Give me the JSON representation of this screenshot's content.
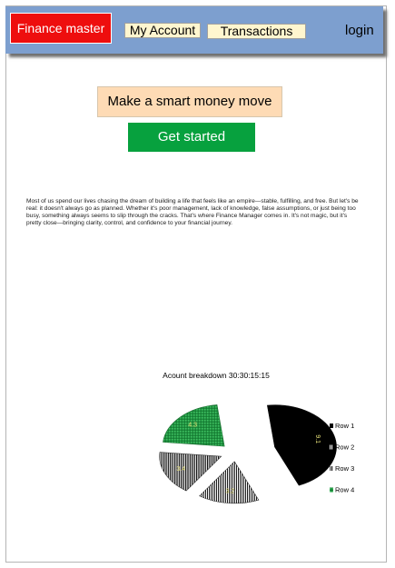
{
  "nav": {
    "brand": "Finance master",
    "account": "My Account",
    "transactions": "Transactions",
    "login": "login"
  },
  "hero": {
    "headline": "Make a smart money move",
    "cta": "Get started"
  },
  "intro": {
    "text": "Most of us spend our lives chasing the dream of building a life that feels like an empire—stable, fulfilling, and free. But let's be real: it doesn't always go as planned. Whether it's poor management, lack of knowledge, false assumptions, or just being too busy, something always seems to slip through the cracks. That's where Finance Manager comes in. It's not magic, but it's pretty close—bringing clarity, control, and confidence to your financial journey."
  },
  "chart_data": {
    "type": "pie",
    "title": "Acount breakdown 30:30:15:15",
    "categories": [
      "Row 1",
      "Row 2",
      "Row 3",
      "Row 4"
    ],
    "values": [
      9.1,
      3.2,
      3.4,
      4.3
    ],
    "data_labels": [
      "9.1",
      "3.2",
      "3.4",
      "4.3"
    ],
    "colors": [
      "#000000",
      "#555555",
      "#444444",
      "#1e9a44"
    ],
    "legend_position": "right"
  }
}
